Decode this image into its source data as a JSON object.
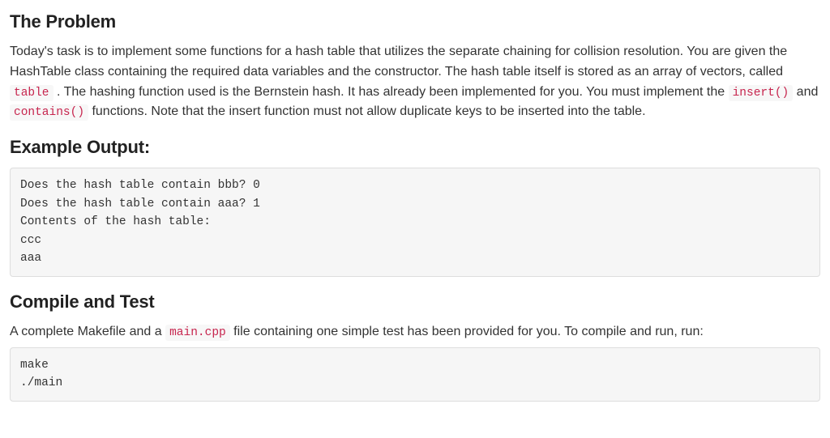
{
  "headings": {
    "problem": "The Problem",
    "example_output": "Example Output:",
    "compile_test": "Compile and Test"
  },
  "problem_text": {
    "part1": "Today's task is to implement some functions for a hash table that utilizes the separate chaining for collision resolution. You are given the HashTable class containing the required data variables and the constructor. The hash table itself is stored as an array of vectors, called ",
    "code_table": "table",
    "part2": " . The hashing function used is the Bernstein hash. It has already been implemented for you. You must implement the ",
    "code_insert": "insert()",
    "part3": " and ",
    "code_contains": "contains()",
    "part4": " functions. Note that the insert function must not allow duplicate keys to be inserted into the table."
  },
  "example_output_block": "Does the hash table contain bbb? 0\nDoes the hash table contain aaa? 1\nContents of the hash table:\nccc\naaa",
  "compile_text": {
    "part1": "A complete Makefile and a ",
    "code_main": "main.cpp",
    "part2": " file containing one simple test has been provided for you. To compile and run, run:"
  },
  "compile_block": "make\n./main"
}
